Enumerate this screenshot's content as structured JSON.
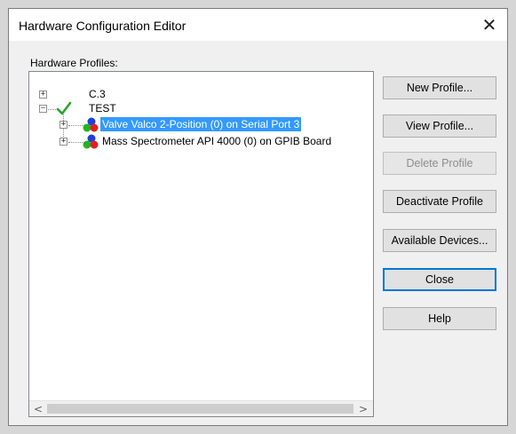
{
  "window": {
    "title": "Hardware Configuration Editor",
    "close_glyph": "✕"
  },
  "profiles_label": "Hardware Profiles:",
  "tree": {
    "nodes": [
      {
        "label": "C.3",
        "expander": "+",
        "active": false
      },
      {
        "label": "TEST",
        "expander": "−",
        "active": true,
        "children": [
          {
            "label": "Valve Valco 2-Position (0) on Serial Port 3",
            "expander": "+",
            "selected": true,
            "icon": "device-icon"
          },
          {
            "label": "Mass Spectrometer API 4000 (0) on GPIB Board",
            "expander": "+",
            "selected": false,
            "icon": "device-icon"
          }
        ]
      }
    ]
  },
  "scrollbar": {
    "left_arrow": "<",
    "right_arrow": ">"
  },
  "buttons": {
    "new_profile": "New Profile...",
    "view_profile": "View Profile...",
    "delete_profile": "Delete Profile",
    "deactivate_profile": "Deactivate Profile",
    "available_devices": "Available Devices...",
    "close": "Close",
    "help": "Help"
  },
  "colors": {
    "selection": "#3399ff",
    "check": "#2aa52a",
    "device_red": "#e02020",
    "device_green": "#22b422",
    "device_blue": "#2040d8"
  }
}
